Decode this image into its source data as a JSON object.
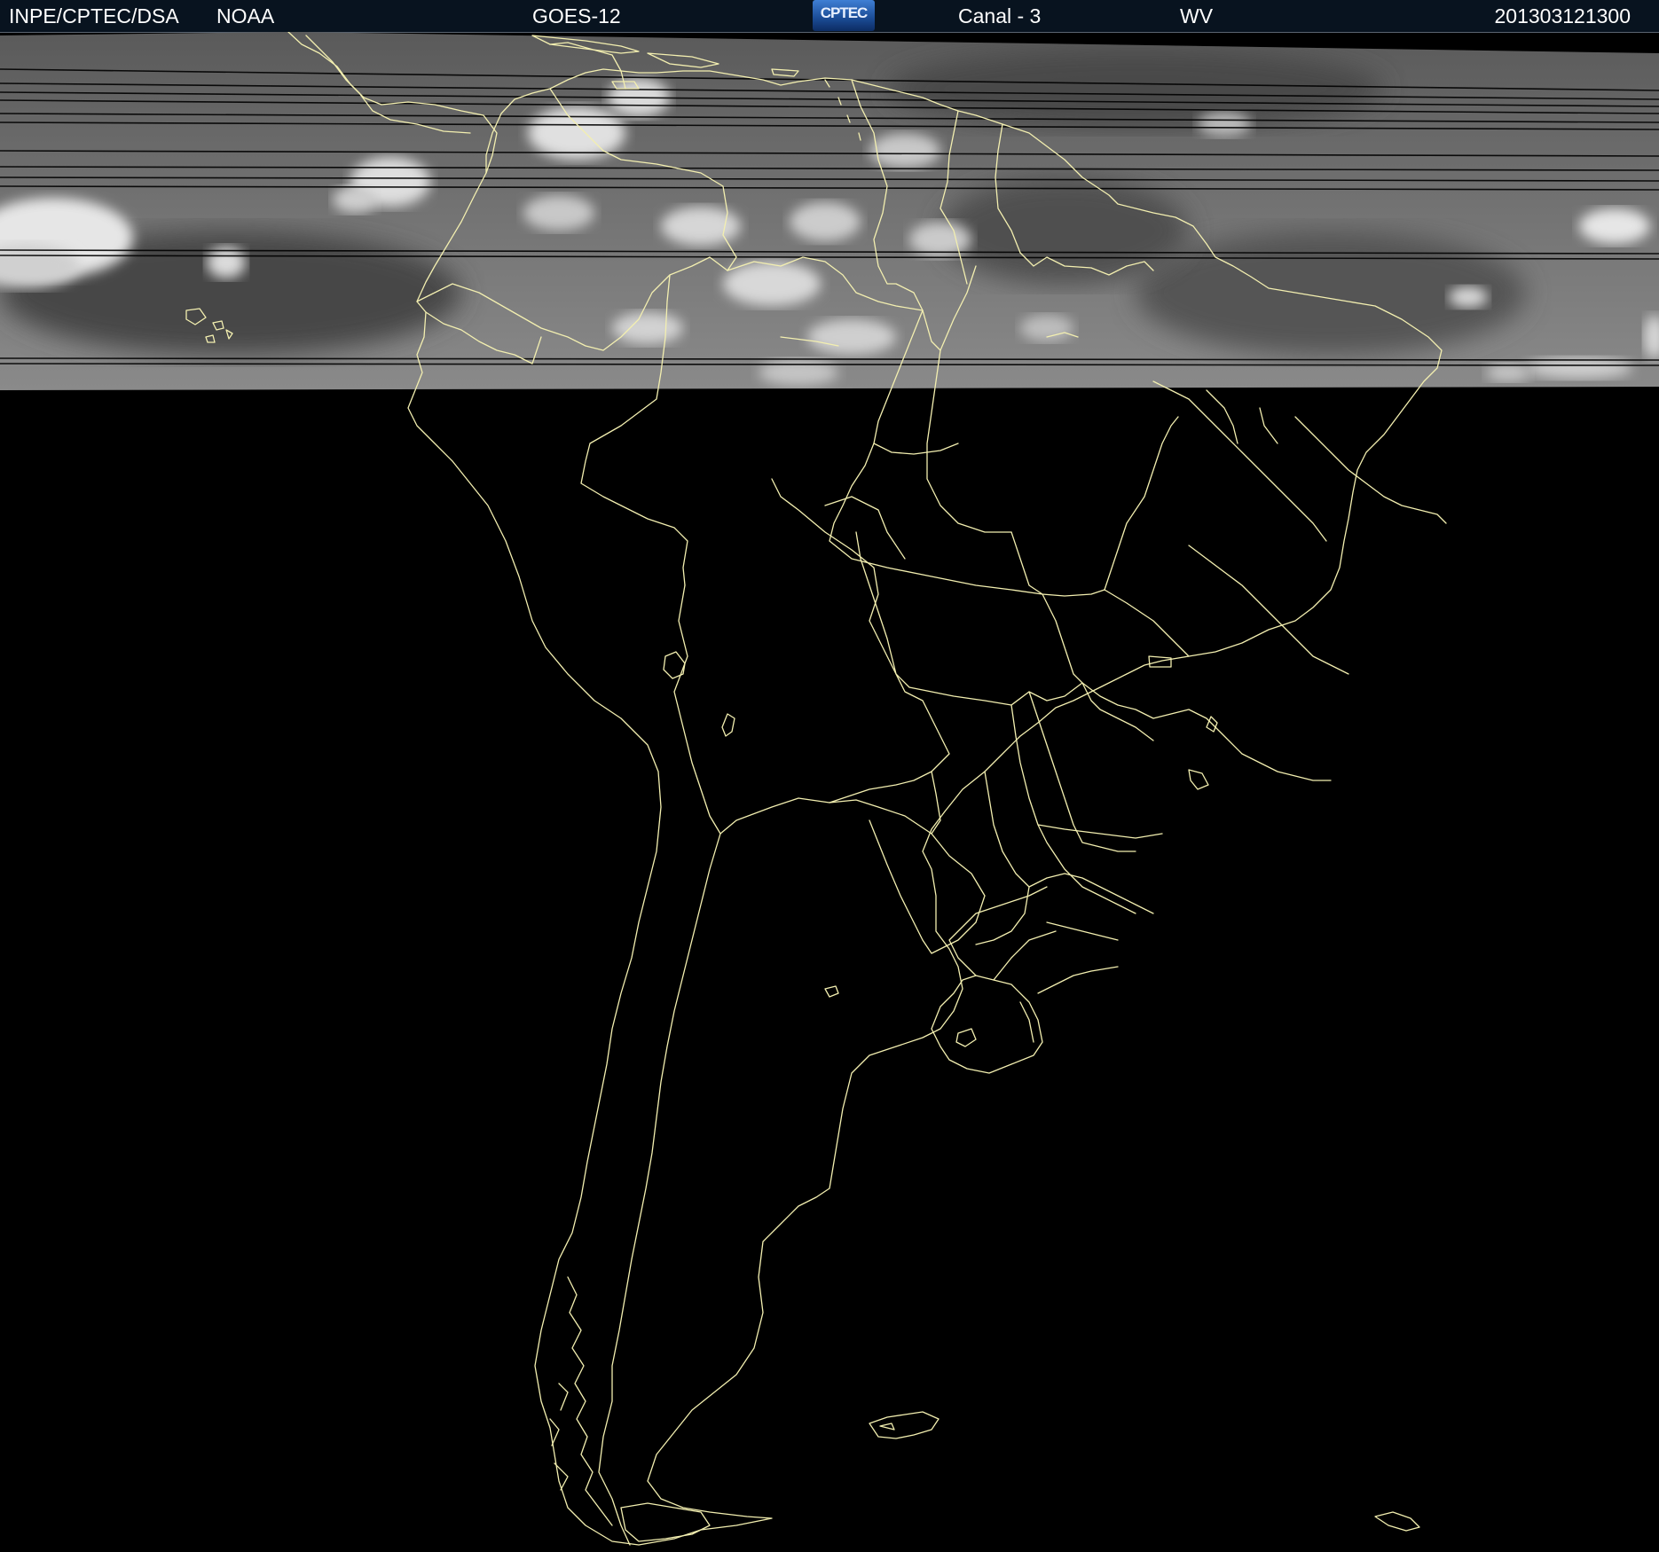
{
  "header": {
    "organization": "INPE/CPTEC/DSA",
    "agency": "NOAA",
    "satellite": "GOES-12",
    "logo_text": "CPTEC",
    "channel": "Canal - 3",
    "band": "WV",
    "timestamp": "201303121300"
  },
  "colors": {
    "background": "#000000",
    "header_background": "#08131f",
    "header_text": "#ffffff",
    "boundary_lines": "#f3efb0",
    "imagery_gray": "#6b6b6b",
    "cloud_white": "#eeeeee"
  }
}
